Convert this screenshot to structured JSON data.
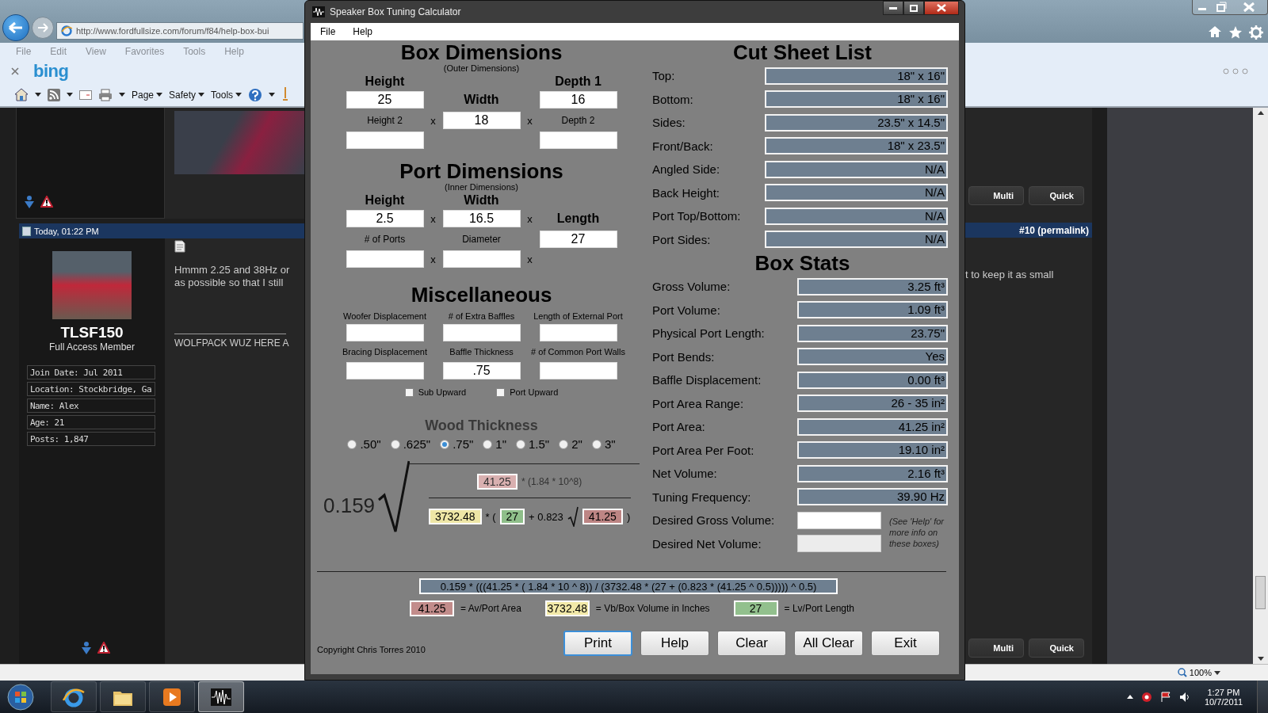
{
  "browser": {
    "url": "http://www.fordfullsize.com/forum/f84/help-box-bui",
    "menu": [
      "File",
      "Edit",
      "View",
      "Favorites",
      "Tools",
      "Help"
    ],
    "search_brand": "bing",
    "command_bar": [
      "Page",
      "Safety",
      "Tools"
    ],
    "zoom": "100%"
  },
  "forum": {
    "post_header": {
      "date": "Today, 01:22 PM",
      "permalink": "#10 (permalink)"
    },
    "user": {
      "name": "TLSF150",
      "title": "Full Access Member",
      "details": [
        "Join Date: Jul 2011",
        "Location: Stockbridge, Ga",
        "Name: Alex",
        "Age: 21",
        "Posts: 1,847"
      ]
    },
    "message_lines": [
      "Hmmm 2.25 and 38Hz or",
      "as possible so that I still"
    ],
    "message_continuation": "t to keep it as small",
    "signature": "WOLFPACK WUZ HERE A",
    "post_buttons_top": [
      "Multi",
      "Quick"
    ],
    "post_buttons_bottom": [
      "Multi",
      "Quick"
    ]
  },
  "calculator": {
    "window": {
      "title": "Speaker Box Tuning Calculator"
    },
    "menu": [
      "File",
      "Help"
    ],
    "box_dimensions": {
      "title": "Box Dimensions",
      "subtitle": "(Outer Dimensions)",
      "fields": [
        {
          "label": "Height",
          "kind": "primary",
          "value": "25"
        },
        {
          "label": "Width",
          "kind": "primary",
          "value": "18"
        },
        {
          "label": "Depth 1",
          "kind": "primary",
          "value": "16"
        },
        {
          "label": "Height 2",
          "kind": "secondary"
        },
        {
          "label": "Depth 2",
          "kind": "secondary"
        }
      ],
      "operators": [
        "x",
        "x"
      ]
    },
    "port_dimensions": {
      "title": "Port Dimensions",
      "subtitle": "(Inner Dimensions)",
      "fields": [
        {
          "label": "Height",
          "kind": "primary",
          "value": "2.5"
        },
        {
          "label": "Width",
          "kind": "primary",
          "value": "16.5"
        },
        {
          "label": "# of Ports",
          "kind": "secondary"
        },
        {
          "label": "Diameter",
          "kind": "secondary"
        },
        {
          "label": "Length",
          "kind": "primary",
          "value": "27"
        }
      ],
      "operators": [
        "x",
        "x",
        "x",
        "x"
      ]
    },
    "miscellaneous": {
      "title": "Miscellaneous",
      "fields": [
        {
          "label": "Woofer Displacement"
        },
        {
          "label": "# of Extra Baffles"
        },
        {
          "label": "Length of External Port"
        },
        {
          "label": "Bracing Displacement"
        },
        {
          "label": "Baffle Thickness",
          "value": ".75"
        },
        {
          "label": "# of Common Port Walls"
        }
      ],
      "options": [
        {
          "label": "Sub Upward",
          "checked": false
        },
        {
          "label": "Port Upward",
          "checked": false
        }
      ]
    },
    "wood_thickness": {
      "title": "Wood Thickness",
      "options": [
        {
          "label": ".50\"",
          "selected": false
        },
        {
          "label": ".625\"",
          "selected": false
        },
        {
          "label": ".75\"",
          "selected": true
        },
        {
          "label": "1\"",
          "selected": false
        },
        {
          "label": "1.5\"",
          "selected": false
        },
        {
          "label": "2\"",
          "selected": false
        },
        {
          "label": "3\"",
          "selected": false
        }
      ]
    },
    "formula": {
      "constant": "0.159",
      "numerator": [
        {
          "kind": "box",
          "text": "41.25",
          "color": "#d9b0b0"
        },
        {
          "kind": "text",
          "text": "* (1.84 * 10^8)"
        }
      ],
      "denominator": [
        {
          "kind": "box",
          "text": "3732.48",
          "color": "#eee6a6"
        },
        {
          "kind": "text",
          "text": "* ("
        },
        {
          "kind": "box",
          "text": "27",
          "color": "#8fbf8a"
        },
        {
          "kind": "text",
          "text": "+ 0.823"
        },
        {
          "kind": "root"
        },
        {
          "kind": "box",
          "text": "41.25",
          "color": "#bd8584"
        },
        {
          "kind": "text",
          "text": ")"
        }
      ]
    },
    "cut_sheet": {
      "title": "Cut Sheet List",
      "rows": [
        {
          "label": "Top:",
          "value": "18\" x 16\""
        },
        {
          "label": "Bottom:",
          "value": "18\" x 16\""
        },
        {
          "label": "Sides:",
          "value": "23.5\" x 14.5\""
        },
        {
          "label": "Front/Back:",
          "value": "18\" x 23.5\""
        },
        {
          "label": "Angled Side:",
          "value": "N/A"
        },
        {
          "label": "Back Height:",
          "value": "N/A"
        },
        {
          "label": "Port Top/Bottom:",
          "value": "N/A"
        },
        {
          "label": "Port Sides:",
          "value": "N/A"
        }
      ]
    },
    "box_stats": {
      "title": "Box Stats",
      "rows": [
        {
          "label": "Gross Volume:",
          "kind": "output",
          "value": "3.25 ft³"
        },
        {
          "label": "Port Volume:",
          "kind": "output",
          "value": "1.09 ft³"
        },
        {
          "label": "Physical Port Length:",
          "kind": "output",
          "value": "23.75\""
        },
        {
          "label": "Port Bends:",
          "kind": "output",
          "value": "Yes"
        },
        {
          "label": "Baffle Displacement:",
          "kind": "output",
          "value": "0.00 ft³"
        },
        {
          "label": "Port Area Range:",
          "kind": "output",
          "value": "26 - 35 in²"
        },
        {
          "label": "Port Area:",
          "kind": "output",
          "value": "41.25 in²"
        },
        {
          "label": "Port Area Per Foot:",
          "kind": "output",
          "value": "19.10 in²"
        },
        {
          "label": "Net Volume:",
          "kind": "output",
          "value": "2.16 ft³"
        },
        {
          "label": "Tuning Frequency:",
          "kind": "output",
          "value": "39.90 Hz"
        },
        {
          "label": "Desired Gross Volume:",
          "kind": "input",
          "disabled": false
        },
        {
          "label": "Desired Net Volume:",
          "kind": "input",
          "disabled": true
        }
      ],
      "note": "(See 'Help' for more info on these boxes)"
    },
    "expression": "0.159 * (((41.25 * ( 1.84 * 10 ^ 8)) / (3732.48 * (27 + (0.823 * (41.25 ^ 0.5))))) ^ 0.5)",
    "legend": [
      {
        "value": "41.25",
        "color": "#c28c8b",
        "label": "= Av/Port Area"
      },
      {
        "value": "3732.48",
        "color": "#f2e9a8",
        "label": "= Vb/Box Volume in Inches"
      },
      {
        "value": "27",
        "color": "#92c08d",
        "label": "= Lv/Port Length"
      }
    ],
    "buttons": [
      {
        "label": "Print",
        "default": true
      },
      {
        "label": "Help",
        "default": false
      },
      {
        "label": "Clear",
        "default": false
      },
      {
        "label": "All Clear",
        "default": false
      },
      {
        "label": "Exit",
        "default": false
      }
    ],
    "copyright": "Copyright Chris Torres 2010"
  },
  "taskbar": {
    "apps": [
      {
        "kind": "browser",
        "active": false
      },
      {
        "kind": "folder",
        "active": false
      },
      {
        "kind": "media",
        "active": false
      },
      {
        "kind": "wave",
        "active": true
      }
    ],
    "time": "1:27 PM",
    "date": "10/7/2011"
  }
}
